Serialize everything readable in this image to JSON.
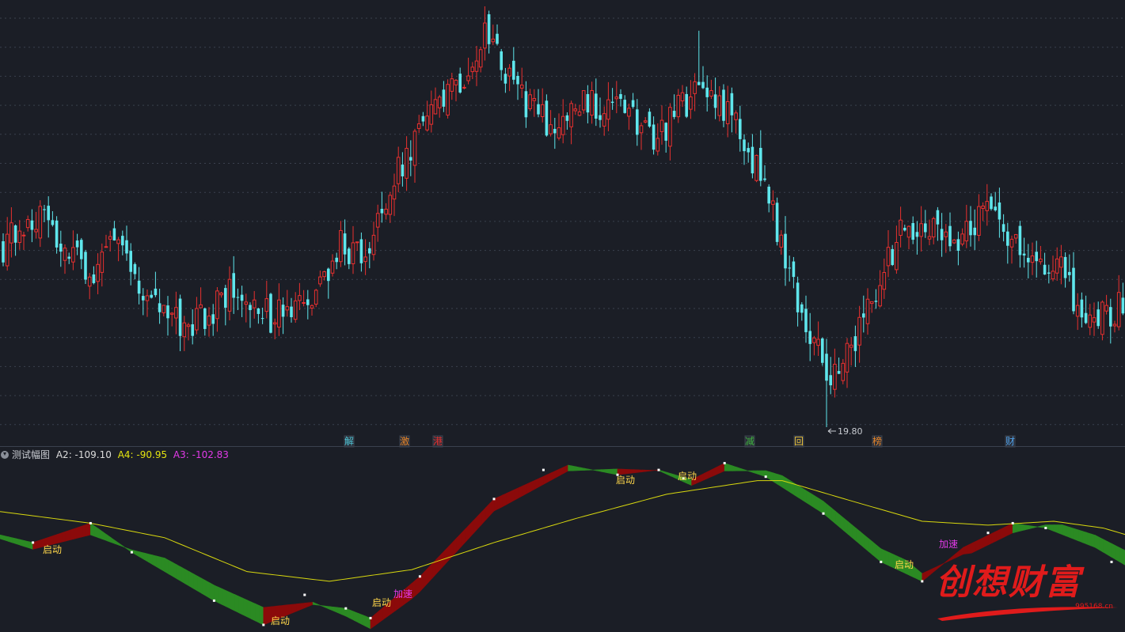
{
  "colors": {
    "background": "#1b1e26",
    "grid": "#3b414e",
    "up_candle": "#e8302f",
    "down_candle": "#5fe6ec",
    "band_up": "#8b0a0a",
    "band_down": "#2b8a23",
    "a4_line": "#d8d80e",
    "label_qidong": "#ffd74a",
    "label_jiasu": "#e23ae8",
    "watermark": "#e01b1b"
  },
  "indicator_header": {
    "name": "测试幅图",
    "a2_label": "A2: -109.10",
    "a4_label": "A4: -90.95",
    "a3_label": "A3: -102.83",
    "a2_color": "#dcdcdc",
    "a4_color": "#e4e40f",
    "a3_color": "#e23ae8"
  },
  "low_annotation": "19.80",
  "event_badges": [
    {
      "text": "解",
      "color": "#4fc7d8"
    },
    {
      "text": "激",
      "color": "#e8862a"
    },
    {
      "text": "港",
      "color": "#e8302f"
    },
    {
      "text": "减",
      "color": "#3fb43f"
    },
    {
      "text": "回",
      "color": "#e8c03a"
    },
    {
      "text": "榜",
      "color": "#e8862a"
    },
    {
      "text": "财",
      "color": "#4fa0e8"
    }
  ],
  "band_labels": [
    {
      "text": "启动",
      "kind": "qidong"
    },
    {
      "text": "启动",
      "kind": "qidong"
    },
    {
      "text": "启动",
      "kind": "qidong"
    },
    {
      "text": "加速",
      "kind": "jiasu"
    },
    {
      "text": "启动",
      "kind": "qidong"
    },
    {
      "text": "启动",
      "kind": "qidong"
    },
    {
      "text": "启动",
      "kind": "qidong"
    },
    {
      "text": "加速",
      "kind": "jiasu"
    }
  ],
  "watermark": {
    "logo_text": "创想财富",
    "site_text": "995168.cn"
  },
  "chart_data": [
    {
      "type": "candlestick",
      "name": "price",
      "price_axis": [
        19.8,
        40.5
      ],
      "anchors": [
        {
          "i": 0,
          "c": 28.7
        },
        {
          "i": 9,
          "c": 30.5
        },
        {
          "i": 15,
          "c": 28.4
        },
        {
          "i": 22,
          "c": 27.6
        },
        {
          "i": 28,
          "c": 29.4
        },
        {
          "i": 35,
          "c": 26.0
        },
        {
          "i": 45,
          "c": 24.5
        },
        {
          "i": 56,
          "c": 26.6
        },
        {
          "i": 65,
          "c": 25.2
        },
        {
          "i": 75,
          "c": 25.6
        },
        {
          "i": 82,
          "c": 29.0
        },
        {
          "i": 88,
          "c": 27.8
        },
        {
          "i": 93,
          "c": 31.3
        },
        {
          "i": 100,
          "c": 33.9
        },
        {
          "i": 108,
          "c": 36.0
        },
        {
          "i": 117,
          "c": 38.9
        },
        {
          "i": 126,
          "c": 36.0
        },
        {
          "i": 133,
          "c": 34.5
        },
        {
          "i": 142,
          "c": 35.8
        },
        {
          "i": 152,
          "c": 35.3
        },
        {
          "i": 158,
          "c": 33.7
        },
        {
          "i": 165,
          "c": 35.7
        },
        {
          "i": 172,
          "c": 36.4
        },
        {
          "i": 180,
          "c": 34.1
        },
        {
          "i": 186,
          "c": 30.9
        },
        {
          "i": 193,
          "c": 26.0
        },
        {
          "i": 200,
          "c": 22.3
        },
        {
          "i": 206,
          "c": 23.8
        },
        {
          "i": 212,
          "c": 26.5
        },
        {
          "i": 218,
          "c": 29.2
        },
        {
          "i": 226,
          "c": 29.8
        },
        {
          "i": 233,
          "c": 29.1
        },
        {
          "i": 240,
          "c": 31.2
        },
        {
          "i": 245,
          "c": 29.0
        },
        {
          "i": 251,
          "c": 27.9
        },
        {
          "i": 257,
          "c": 27.4
        },
        {
          "i": 262,
          "c": 25.2
        },
        {
          "i": 268,
          "c": 25.3
        },
        {
          "i": 272,
          "c": 25.9
        }
      ],
      "low_marker": 19.8
    },
    {
      "type": "band",
      "name": "A2/A3",
      "value_axis": [
        -109.1,
        60
      ],
      "a_points": [
        [
          0,
          -12
        ],
        [
          8,
          -20
        ],
        [
          22,
          0
        ],
        [
          32,
          -30
        ],
        [
          52,
          -80
        ],
        [
          64,
          -105
        ],
        [
          76,
          -84
        ],
        [
          84,
          -88
        ],
        [
          90,
          -98
        ],
        [
          102,
          -55
        ],
        [
          120,
          25
        ],
        [
          138,
          60
        ],
        [
          150,
          50
        ],
        [
          160,
          55
        ],
        [
          168,
          45
        ],
        [
          176,
          62
        ],
        [
          186,
          48
        ],
        [
          200,
          10
        ],
        [
          214,
          -40
        ],
        [
          224,
          -60
        ],
        [
          234,
          -25
        ],
        [
          246,
          0
        ],
        [
          254,
          -5
        ],
        [
          266,
          -25
        ],
        [
          276,
          -50
        ]
      ],
      "b_offset": [
        [
          0,
          -4
        ],
        [
          22,
          -12
        ],
        [
          40,
          14
        ],
        [
          64,
          18
        ],
        [
          84,
          -8
        ],
        [
          100,
          -16
        ],
        [
          122,
          -12
        ],
        [
          138,
          -6
        ],
        [
          150,
          6
        ],
        [
          168,
          -6
        ],
        [
          176,
          -8
        ],
        [
          190,
          12
        ],
        [
          220,
          14
        ],
        [
          236,
          -10
        ],
        [
          246,
          -10
        ],
        [
          258,
          10
        ],
        [
          276,
          16
        ]
      ],
      "a4_points": [
        [
          0,
          12
        ],
        [
          22,
          0
        ],
        [
          40,
          -15
        ],
        [
          60,
          -50
        ],
        [
          80,
          -60
        ],
        [
          100,
          -48
        ],
        [
          120,
          -20
        ],
        [
          140,
          5
        ],
        [
          162,
          30
        ],
        [
          184,
          44
        ],
        [
          190,
          44
        ],
        [
          206,
          24
        ],
        [
          224,
          2
        ],
        [
          240,
          -2
        ],
        [
          256,
          2
        ],
        [
          268,
          -5
        ],
        [
          276,
          -15
        ]
      ],
      "white_dots": [
        [
          8,
          -20
        ],
        [
          22,
          0
        ],
        [
          32,
          -30
        ],
        [
          52,
          -80
        ],
        [
          64,
          -105
        ],
        [
          74,
          -74
        ],
        [
          84,
          -88
        ],
        [
          90,
          -98
        ],
        [
          102,
          -55
        ],
        [
          120,
          25
        ],
        [
          132,
          55
        ],
        [
          150,
          50
        ],
        [
          160,
          55
        ],
        [
          166,
          46
        ],
        [
          176,
          62
        ],
        [
          186,
          48
        ],
        [
          200,
          10
        ],
        [
          214,
          -40
        ],
        [
          224,
          -60
        ],
        [
          240,
          -10
        ],
        [
          246,
          0
        ],
        [
          254,
          -5
        ],
        [
          270,
          -40
        ]
      ]
    }
  ]
}
